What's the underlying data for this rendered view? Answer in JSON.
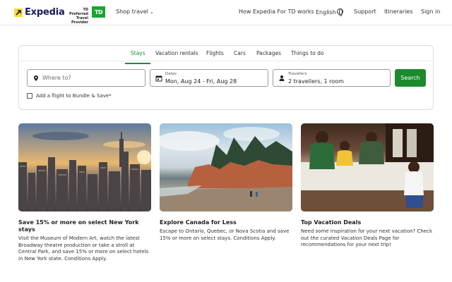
{
  "header": {
    "brand": "Expedia",
    "partner_line1": "TD Preferred",
    "partner_line2": "Travel Provider",
    "td_logo": "TD",
    "shop_travel": "Shop travel",
    "nav": {
      "how_expedia": "How Expedia For TD works",
      "language": "English",
      "support": "Support",
      "itineraries": "Itineraries",
      "sign_in": "Sign in"
    }
  },
  "search": {
    "tabs": [
      "Stays",
      "Vacation rentals",
      "Flights",
      "Cars",
      "Packages",
      "Things to do"
    ],
    "active_tab": "Stays",
    "where_placeholder": "Where to?",
    "dates_label": "Dates",
    "dates_value": "Mon, Aug 24 - Fri, Aug 28",
    "travellers_label": "Travellers",
    "travellers_value": "2 travellers, 1 room",
    "search_button": "Search",
    "bundle_label": "Add a flight to Bundle & Save*",
    "bundle_checked": false
  },
  "promos": [
    {
      "title": "Save 15% or more on select New York stays",
      "description": "Visit the Museum of Modern Art, watch the latest Broadway theatre production or take a stroll at Central Park, and save 15% or more on select hotels in New York state. Conditions Apply."
    },
    {
      "title": "Explore Canada for Less",
      "description": "Escape to Ontario, Quebec, or Nova Scotia and save 15% or more on select stays. Conditions Apply."
    },
    {
      "title": "Top Vacation Deals",
      "description": "Need some inspiration for your next vacation? Check out the curated Vacation Deals Page for recommendations for your next trip!"
    }
  ],
  "colors": {
    "accent_green": "#1a8a2d",
    "brand_navy": "#1a1a5e",
    "brand_yellow": "#fddb32",
    "td_green": "#1aa431"
  },
  "icons": [
    "expedia-logo-icon",
    "chevron-down-icon",
    "globe-icon",
    "location-pin-icon",
    "calendar-icon",
    "person-icon"
  ]
}
